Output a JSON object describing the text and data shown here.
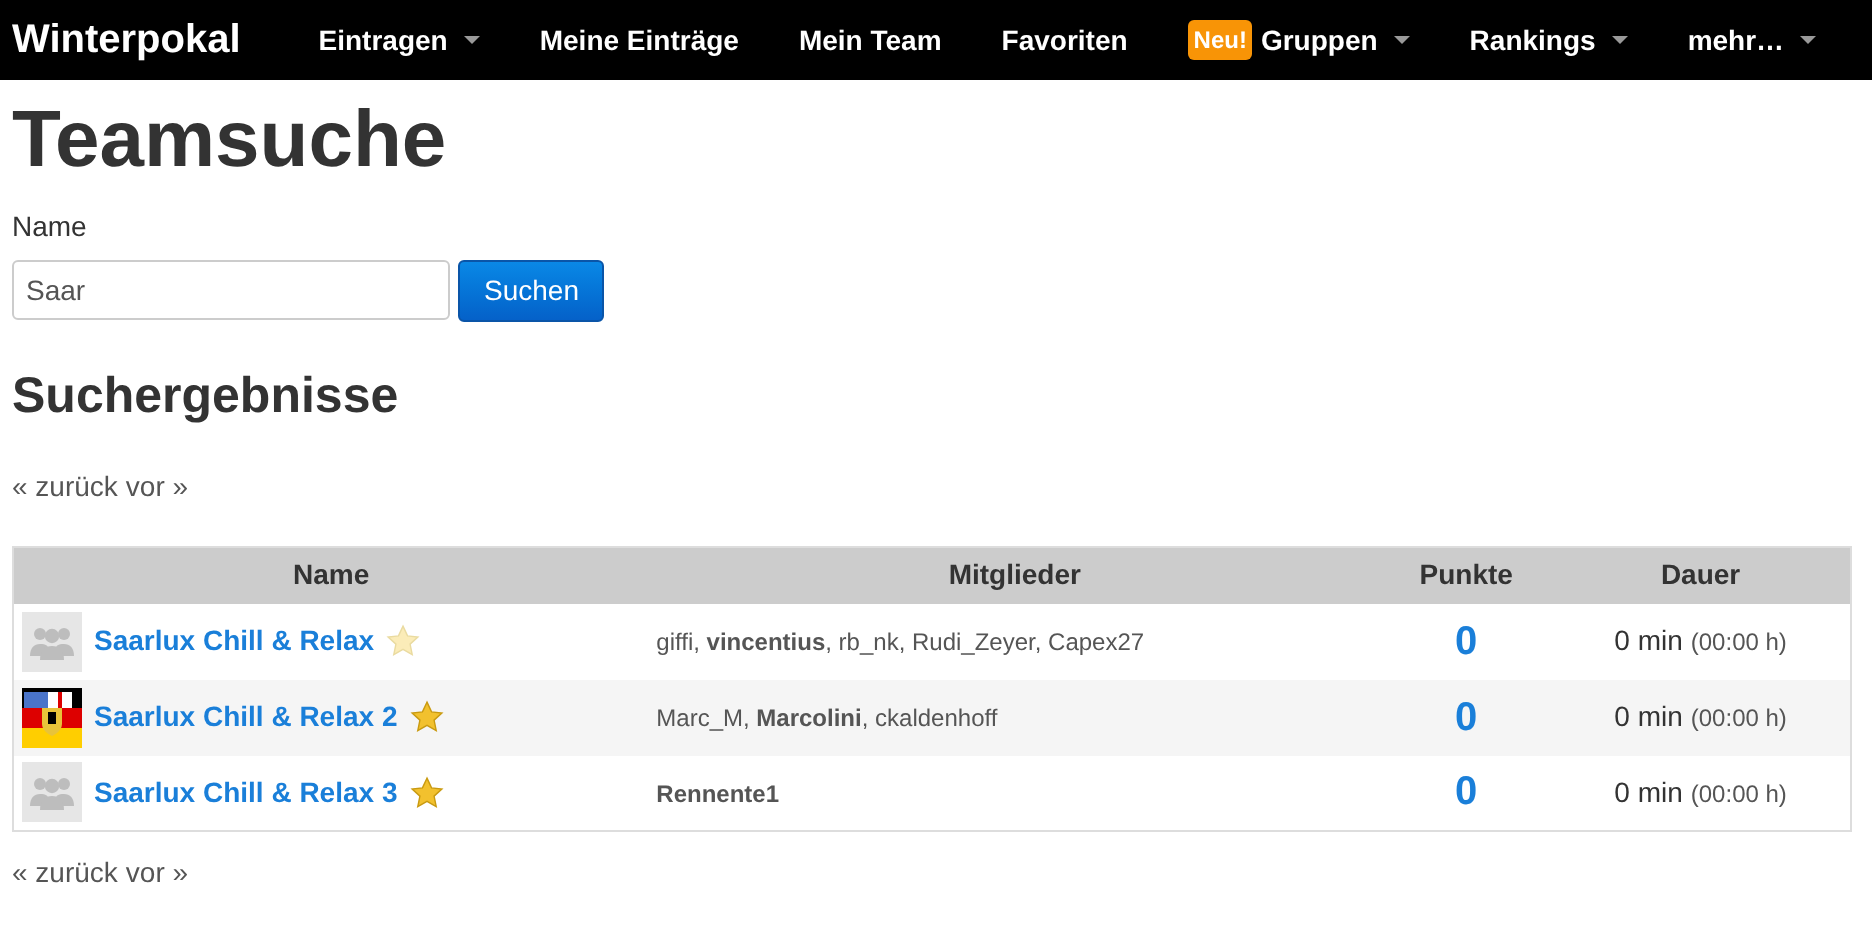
{
  "navbar": {
    "brand": "Winterpokal",
    "items": [
      {
        "label": "Eintragen",
        "dropdown": true
      },
      {
        "label": "Meine Einträge",
        "dropdown": false
      },
      {
        "label": "Mein Team",
        "dropdown": false
      },
      {
        "label": "Favoriten",
        "dropdown": false
      },
      {
        "label": "Gruppen",
        "dropdown": true,
        "badge": "Neu!"
      },
      {
        "label": "Rankings",
        "dropdown": true
      },
      {
        "label": "mehr…",
        "dropdown": true
      }
    ]
  },
  "title": "Teamsuche",
  "search": {
    "label": "Name",
    "value": "Saar",
    "button": "Suchen"
  },
  "results_heading": "Suchergebnisse",
  "pagination_top": [
    "« zurück",
    "vor »"
  ],
  "table": {
    "columns": [
      "Name",
      "Mitglieder",
      "Punkte",
      "Dauer"
    ],
    "rows": [
      {
        "kind": "group",
        "name": "Saarlux Chill & Relax",
        "favorite": false,
        "members": "giffi, **vincentius**, rb_nk, Rudi_Zeyer, Capex27",
        "points": "0",
        "duration": "0 min",
        "duration_hours": "(00:00 h)"
      },
      {
        "kind": "flag",
        "name": "Saarlux Chill & Relax 2",
        "favorite": true,
        "members": "Marc_M, **Marcolini**, ckaldenhoff",
        "points": "0",
        "duration": "0 min",
        "duration_hours": "(00:00 h)"
      },
      {
        "kind": "group",
        "name": "Saarlux Chill & Relax 3",
        "favorite": true,
        "members": "**Rennente1**",
        "points": "0",
        "duration": "0 min",
        "duration_hours": "(00:00 h)"
      }
    ]
  },
  "pagination_bottom": [
    "« zurück",
    "vor »"
  ]
}
